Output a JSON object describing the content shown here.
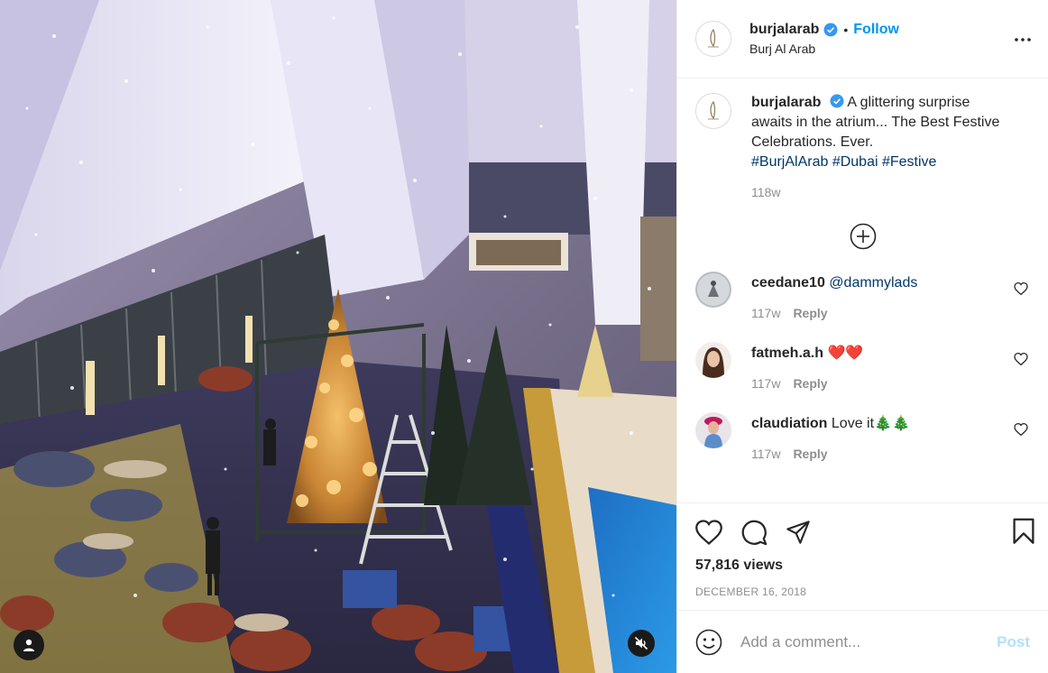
{
  "post": {
    "username": "burjalarab",
    "location": "Burj Al Arab",
    "follow_label": "Follow",
    "separator": "•",
    "caption_text": "A glittering surprise awaits in the atrium... The Best Festive Celebrations. Ever.",
    "hashtags": [
      "#BurjAlArab",
      "#Dubai",
      "#Festive"
    ],
    "caption_time": "118w",
    "views": "57,816 views",
    "date": "DECEMBER 16, 2018"
  },
  "comments": [
    {
      "username": "ceedane10",
      "mention": "@dammylads",
      "text": "",
      "time": "117w",
      "reply_label": "Reply"
    },
    {
      "username": "fatmeh.a.h",
      "text": "❤️❤️",
      "time": "117w",
      "reply_label": "Reply"
    },
    {
      "username": "claudiation",
      "text": "Love it🎄🎄",
      "time": "117w",
      "reply_label": "Reply"
    }
  ],
  "add_comment": {
    "placeholder": "Add a comment...",
    "post_label": "Post"
  },
  "colors": {
    "link_blue": "#0095f6",
    "hashtag": "#00376b",
    "muted": "#8e8e8e",
    "post_disabled": "#b2dffc",
    "verified": "#3897f0"
  },
  "icons": [
    "verified-icon",
    "more-options-icon",
    "load-more-icon",
    "heart-icon",
    "comment-icon",
    "share-icon",
    "bookmark-icon",
    "emoji-icon",
    "user-tag-icon",
    "mute-icon"
  ]
}
